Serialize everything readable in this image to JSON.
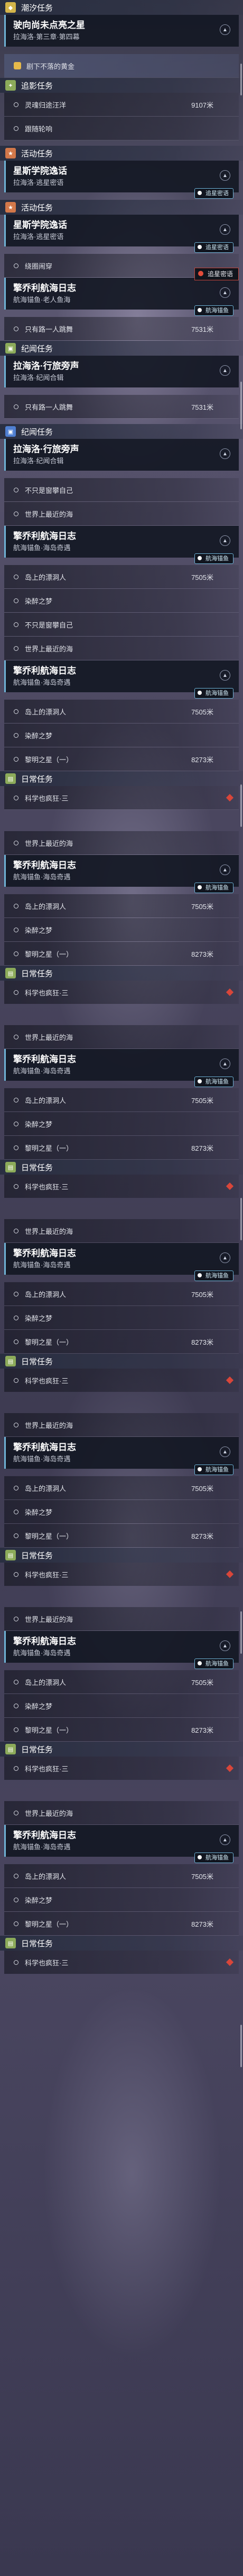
{
  "sections": [
    {
      "category": {
        "label": "潮汐任务",
        "icon": "tide-icon",
        "color": "yellow"
      },
      "quest": {
        "title": "驶向尚未点亮之星",
        "sub": "拉海洛·第三章·第四幕"
      },
      "objectives": [
        {
          "text": "剧下不落的黄金",
          "highlight": true
        }
      ]
    },
    {
      "category": {
        "label": "追影任务",
        "icon": "chase-icon",
        "color": "green"
      },
      "objectives": [
        {
          "text": "灵魂归途汪洋",
          "dist": "9107米"
        },
        {
          "text": "跟随轮响"
        }
      ]
    },
    {
      "category": {
        "label": "活动任务",
        "icon": "event-icon",
        "color": "orange"
      },
      "quest": {
        "title": "星斯学院逸话",
        "sub": "拉海洛·逃星密语",
        "tag": "追星密语"
      }
    },
    {
      "category": {
        "label": "活动任务",
        "icon": "event-icon",
        "color": "orange"
      },
      "quest": {
        "title": "星斯学院逸话",
        "sub": "拉海洛·逃星密语",
        "tag": "追星密语"
      },
      "objectives": [
        {
          "text": "绕圈闹穿"
        }
      ]
    },
    {
      "quest": {
        "title": "擎乔利航海日志",
        "sub": "航海锚鱼·老人鱼海",
        "tag": "航海锚鱼"
      },
      "objectives": [
        {
          "text": "只有路一人跳舞",
          "dist": "7531米"
        }
      ]
    },
    {
      "category": {
        "label": "纪闻任务",
        "icon": "chronicle-icon",
        "color": "green"
      },
      "quest": {
        "title": "拉海洛·行旅旁声",
        "sub": "拉海洛·纪闻合辑"
      },
      "objectives": [
        {
          "text": "只有路一人跳舞",
          "dist": "7531米"
        }
      ]
    },
    {
      "category": {
        "label": "纪闻任务",
        "icon": "chronicle-icon",
        "color": "blue"
      },
      "quest": {
        "title": "拉海洛·行旅旁声",
        "sub": "拉海洛·纪闻合辑"
      },
      "objectives": [
        {
          "text": "不只是窗攀自己"
        },
        {
          "text": "世界上最近的海"
        }
      ]
    },
    {
      "quest": {
        "title": "擎乔利航海日志",
        "sub": "航海锚鱼·海岛奇遇",
        "tag": "航海锚鱼"
      },
      "objectives": [
        {
          "text": "岛上的漂洞人",
          "dist": "7505米"
        },
        {
          "text": "染醉之梦"
        }
      ]
    },
    {
      "objectives": [
        {
          "text": "不只是窗攀自己"
        },
        {
          "text": "世界上最近的海"
        }
      ]
    },
    {
      "quest": {
        "title": "擎乔利航海日志",
        "sub": "航海锚鱼·海岛奇遇",
        "tag": "航海锚鱼"
      },
      "objectives": [
        {
          "text": "岛上的漂洞人",
          "dist": "7505米"
        },
        {
          "text": "染醉之梦"
        },
        {
          "text": "黎明之星（一）",
          "dist": "8273米"
        }
      ]
    },
    {
      "category": {
        "label": "日常任务",
        "icon": "daily-icon",
        "color": "green"
      },
      "objectives": [
        {
          "text": "科学也疯狂·三",
          "red": true
        }
      ]
    }
  ],
  "repeat_block": {
    "objectives_a": [
      {
        "text": "世界上最近的海"
      }
    ],
    "quest": {
      "title": "擎乔利航海日志",
      "sub": "航海锚鱼·海岛奇遇",
      "tag": "航海锚鱼"
    },
    "objectives_b": [
      {
        "text": "岛上的漂洞人",
        "dist": "7505米"
      },
      {
        "text": "染醉之梦"
      },
      {
        "text": "黎明之星（一）",
        "dist": "8273米"
      }
    ],
    "daily": {
      "label": "日常任务",
      "item": "科学也疯狂·三"
    }
  },
  "tracking_label": "追星密语"
}
